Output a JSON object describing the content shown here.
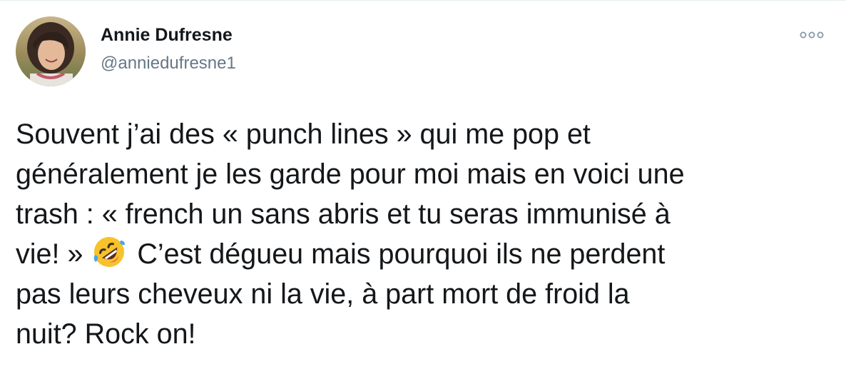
{
  "tweet": {
    "author": {
      "name": "Annie Dufresne",
      "handle": "@anniedufresne1",
      "avatar_icon": "profile-photo"
    },
    "more_icon": "more-dots-icon",
    "text_lines": [
      "Souvent j’ai des « punch lines » qui me pop et",
      "généralement je les garde pour moi mais en voici une",
      "trash : « french un sans abris et tu seras immunisé à",
      {
        "before": "vie! » ",
        "emoji": "rolling-on-floor-laughing-emoji",
        "after": " C’est dégueu mais pourquoi ils ne perdent"
      },
      "pas leurs cheveux ni la vie, à part mort de froid la",
      "nuit? Rock on!"
    ],
    "colors": {
      "text": "#14171a",
      "secondary_text": "#657786",
      "border": "#e6ecf0",
      "emoji_face": "#f7c22b",
      "emoji_tear": "#4aa6e8"
    }
  }
}
